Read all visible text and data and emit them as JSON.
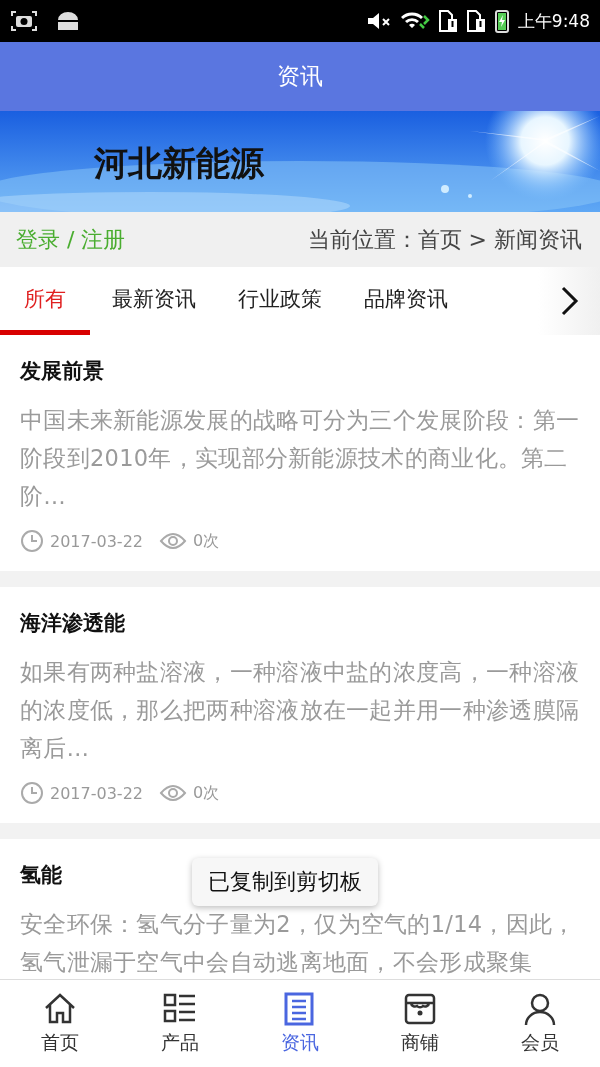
{
  "status_bar": {
    "time": "上午9:48"
  },
  "header": {
    "title": "资讯"
  },
  "banner": {
    "kind": "picture",
    "title": "河北新能源"
  },
  "breadcrumb": {
    "login": "登录 / 注册",
    "location": "当前位置：首页 > 新闻资讯"
  },
  "tabs": [
    {
      "label": "所有",
      "selected": true
    },
    {
      "label": "最新资讯",
      "selected": false
    },
    {
      "label": "行业政策",
      "selected": false
    },
    {
      "label": "品牌资讯",
      "selected": false
    }
  ],
  "articles": [
    {
      "title": "发展前景",
      "summary": "中国未来新能源发展的战略可分为三个发展阶段：第一阶段到2010年，实现部分新能源技术的商业化。第二阶…",
      "date": "2017-03-22",
      "views": "0次"
    },
    {
      "title": "海洋渗透能",
      "summary": "如果有两种盐溶液，一种溶液中盐的浓度高，一种溶液的浓度低，那么把两种溶液放在一起并用一种渗透膜隔离后…",
      "date": "2017-03-22",
      "views": "0次"
    },
    {
      "title": "氢能",
      "summary": "安全环保：氢气分子量为2，仅为空气的1/14，因此，氢气泄漏于空气中会自动逃离地面，不会形成聚集"
    }
  ],
  "toast": "已复制到剪切板",
  "bottom_nav": [
    {
      "label": "首页",
      "kind": "home",
      "selected": false
    },
    {
      "label": "产品",
      "kind": "list",
      "selected": false
    },
    {
      "label": "资讯",
      "kind": "news",
      "selected": true
    },
    {
      "label": "商铺",
      "kind": "shop",
      "selected": false
    },
    {
      "label": "会员",
      "kind": "user",
      "selected": false
    }
  ]
}
